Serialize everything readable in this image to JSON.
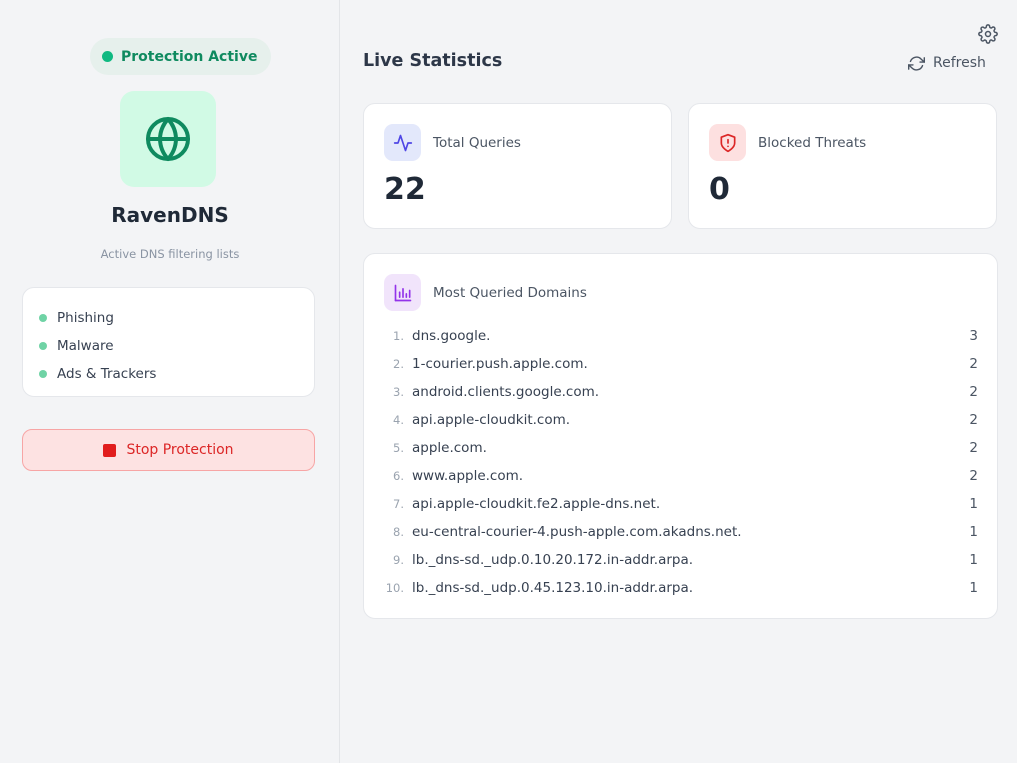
{
  "sidebar": {
    "status": {
      "label": "Protection Active",
      "color": "#10b981"
    },
    "app_name": "RavenDNS",
    "logo_icon": "globe-icon",
    "lists_caption": "Active DNS filtering lists",
    "filter_lists": [
      {
        "label": "Phishing"
      },
      {
        "label": "Malware"
      },
      {
        "label": "Ads & Trackers"
      }
    ],
    "stop_button": {
      "label": "Stop Protection",
      "icon": "stop-square-icon"
    }
  },
  "main": {
    "title": "Live Statistics",
    "refresh_label": "Refresh",
    "settings_icon": "gear-icon",
    "stats": {
      "total_queries": {
        "label": "Total Queries",
        "value": "22",
        "icon": "activity-icon"
      },
      "blocked_threats": {
        "label": "Blocked Threats",
        "value": "0",
        "icon": "shield-alert-icon"
      }
    },
    "domains": {
      "title": "Most Queried Domains",
      "icon": "bar-chart-icon",
      "rows": [
        {
          "rank": "1.",
          "name": "dns.google.",
          "count": "3"
        },
        {
          "rank": "2.",
          "name": "1-courier.push.apple.com.",
          "count": "2"
        },
        {
          "rank": "3.",
          "name": "android.clients.google.com.",
          "count": "2"
        },
        {
          "rank": "4.",
          "name": "api.apple-cloudkit.com.",
          "count": "2"
        },
        {
          "rank": "5.",
          "name": "apple.com.",
          "count": "2"
        },
        {
          "rank": "6.",
          "name": "www.apple.com.",
          "count": "2"
        },
        {
          "rank": "7.",
          "name": "api.apple-cloudkit.fe2.apple-dns.net.",
          "count": "1"
        },
        {
          "rank": "8.",
          "name": "eu-central-courier-4.push-apple.com.akadns.net.",
          "count": "1"
        },
        {
          "rank": "9.",
          "name": "lb._dns-sd._udp.0.10.20.172.in-addr.arpa.",
          "count": "1"
        },
        {
          "rank": "10.",
          "name": "lb._dns-sd._udp.0.45.123.10.in-addr.arpa.",
          "count": "1"
        }
      ]
    }
  }
}
